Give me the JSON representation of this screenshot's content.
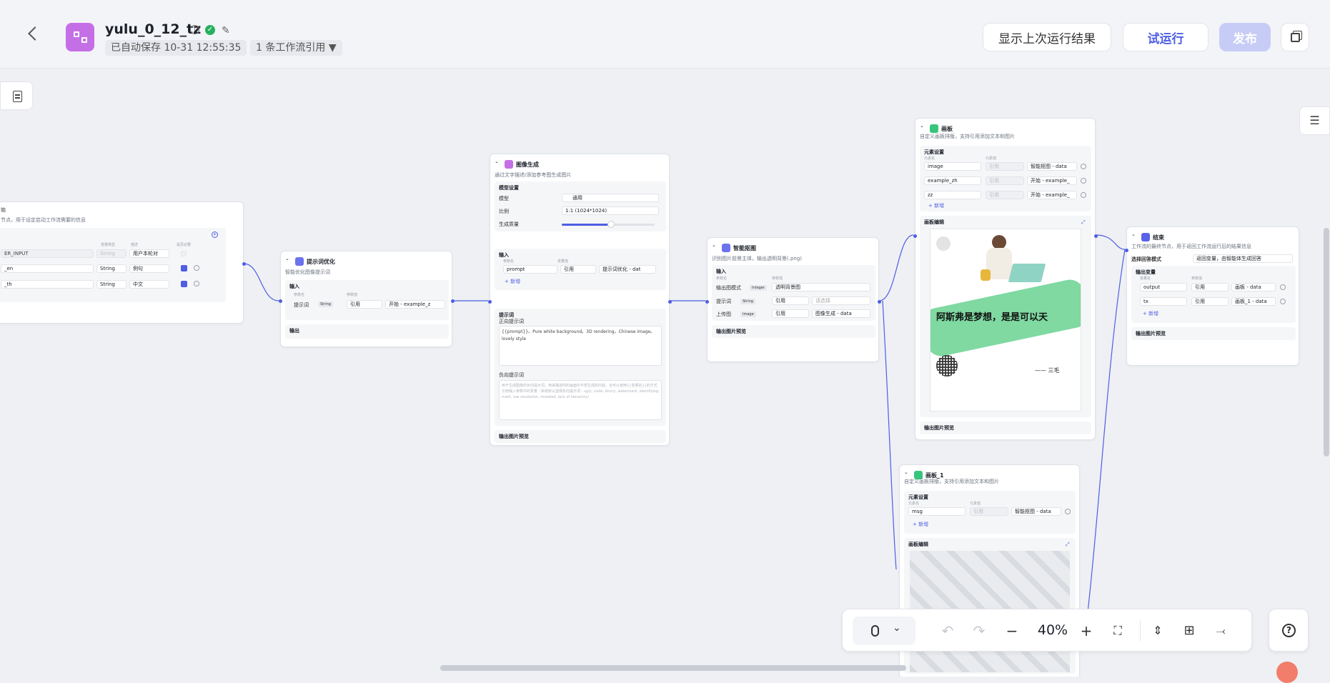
{
  "header": {
    "title": "yulu_0_12_tz",
    "autosave": "已自动保存 10-31 12:55:35",
    "refs": "1 条工作流引用",
    "show_last_result": "显示上次运行结果",
    "test_run": "试运行",
    "publish": "发布"
  },
  "nodes": {
    "start": {
      "desc_fragment": "节点，用于设定启动工作流需要的信息",
      "title_fragment": "始",
      "col_type": "变量类型",
      "col_desc": "描述",
      "col_required": "是否必要",
      "rows": [
        {
          "name": "ER_INPUT",
          "type": "String",
          "desc": "用户本轮对"
        },
        {
          "name": "_en",
          "type": "String",
          "desc": "例句"
        },
        {
          "name": "_th",
          "type": "String",
          "desc": "中文"
        }
      ]
    },
    "prompt_opt": {
      "title": "提示词优化",
      "desc": "智能优化图像提示词",
      "input": "输入",
      "col_name": "参数名",
      "col_value": "参数值",
      "param": "提示词",
      "type": "String",
      "ref": "引用",
      "value": "开始 - example_z",
      "output": "输出"
    },
    "image_gen": {
      "title": "图像生成",
      "desc": "通过文字描述/添加参考图生成图片",
      "model_settings": "模型设置",
      "model_label": "模型",
      "model_value": "通用",
      "ratio_label": "比例",
      "ratio_value": "1:1 (1024*1024)",
      "quality_label": "生成质量",
      "input": "输入",
      "col_name": "参数名",
      "col_value": "变量值",
      "param": "prompt",
      "ref": "引用",
      "param_value": "提示词优化 - dat",
      "add": "+ 新增",
      "prompt_section": "提示词",
      "positive_label": "正向提示词",
      "positive_text": "{{prompt}}。Pure white background。3D rendering。Chinese image。lovely style",
      "negative_label": "负向提示词",
      "negative_placeholder": "用于生成图像的负向提示词，用来描述你的画面中不想生成的内容。也可以使用{{变量名}}的方式引用输入参数中的变量（系统默认选择负向提示词：ugly, nude, blurry, watermark, identifying mark, low resolution, mutated, lack of hierarchy）",
      "preview": "输出图片预览"
    },
    "smart_cut": {
      "title": "智能抠图",
      "desc": "识别图片前景主体，输出透明背景(.png)",
      "input": "输入",
      "col_name": "参数名",
      "col_value": "参数值",
      "mode_label": "输出图模式",
      "mode_type": "Integer",
      "mode_value": "透明背景图",
      "prompt_label": "提示词",
      "prompt_type": "String",
      "ref": "引用",
      "prompt_value": "请选择",
      "upload_label": "上传图",
      "upload_type": "Image",
      "upload_value": "图像生成 - data",
      "preview": "输出图片预览"
    },
    "canvas1": {
      "title": "画板",
      "desc": "自定义画板排版，支持引用添加文本和图片",
      "elements": "元素设置",
      "col_name": "元素名",
      "col_value": "元素值",
      "rows": [
        {
          "name": "image",
          "ref": "引用",
          "value": "智能抠图 - data"
        },
        {
          "name": "example_zh",
          "ref": "引用",
          "value": "开始 - example_"
        },
        {
          "name": "zz",
          "ref": "引用",
          "value": "开始 - example_"
        }
      ],
      "add": "+ 新增",
      "edit": "画板编辑",
      "poster_text": "阿斯弗是梦想，是是可以天",
      "poster_sign": "—— 三毛",
      "preview": "输出图片预览"
    },
    "canvas2": {
      "title": "画板_1",
      "desc": "自定义画板排版，支持引用添加文本和图片",
      "elements": "元素设置",
      "col_name": "元素名",
      "col_value": "元素值",
      "row_name": "msg",
      "row_ref": "引用",
      "row_value": "智能抠图 - data",
      "add": "+ 新增",
      "edit": "画板编辑"
    },
    "end": {
      "title": "结束",
      "desc": "工作流的最终节点，用于返回工作流运行后的结果信息",
      "mode_label": "选择回答模式",
      "mode_value": "返回变量，由智能体生成回答",
      "output_vars": "输出变量",
      "col_name": "变量名",
      "col_value": "参数值",
      "rows": [
        {
          "name": "output",
          "ref": "引用",
          "value": "画板 - data"
        },
        {
          "name": "tx",
          "ref": "引用",
          "value": "画板_1 - data"
        }
      ],
      "add": "+ 新增",
      "preview": "输出图片预览"
    }
  },
  "toolbar": {
    "zoom": "40%"
  },
  "colors": {
    "accent": "#4e5ee4",
    "publish_disabled": "#c7ccf7",
    "app_icon": "#c56fe6"
  }
}
